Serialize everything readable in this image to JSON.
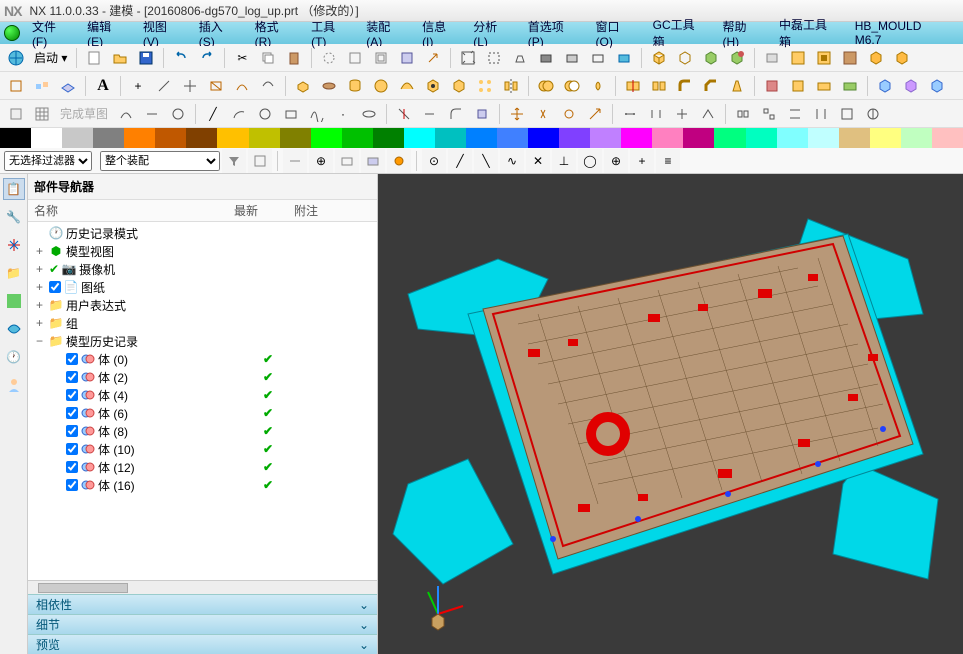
{
  "title": "NX 11.0.0.33 - 建模 - [20160806-dg570_log_up.prt （修改的）]",
  "menu": [
    "文件(F)",
    "编辑(E)",
    "视图(V)",
    "插入(S)",
    "格式(R)",
    "工具(T)",
    "装配(A)",
    "信息(I)",
    "分析(L)",
    "首选项(P)",
    "窗口(O)",
    "GC工具箱",
    "帮助(H)",
    "中磊工具箱",
    "HB_MOULD M6.7"
  ],
  "start_label": "启动",
  "filter1": "无选择过滤器",
  "filter2": "整个装配",
  "nav_header": "部件导航器",
  "nav_cols": {
    "name": "名称",
    "latest": "最新",
    "note": "附注"
  },
  "tree": {
    "history_mode": "历史记录模式",
    "model_view": "模型视图",
    "camera": "摄像机",
    "drawing": "图纸",
    "user_expr": "用户表达式",
    "group": "组",
    "history": "模型历史记录",
    "bodies": [
      "体 (0)",
      "体 (2)",
      "体 (4)",
      "体 (6)",
      "体 (8)",
      "体 (10)",
      "体 (12)",
      "体 (16)"
    ]
  },
  "sections": {
    "deps": "相依性",
    "detail": "细节",
    "preview": "预览"
  },
  "colors": [
    "#000000",
    "#ffffff",
    "#c8c8c8",
    "#808080",
    "#ff8000",
    "#c05800",
    "#804000",
    "#ffc000",
    "#c0c000",
    "#808000",
    "#00ff00",
    "#00c000",
    "#008000",
    "#00ffff",
    "#00c0c0",
    "#0080ff",
    "#4080ff",
    "#0000ff",
    "#8040ff",
    "#c080ff",
    "#ff00ff",
    "#ff80c0",
    "#c00080",
    "#00ff80",
    "#00ffc0",
    "#80ffff",
    "#c0ffff",
    "#e0c080",
    "#ffff80",
    "#c0ffc0",
    "#ffc0c0"
  ]
}
